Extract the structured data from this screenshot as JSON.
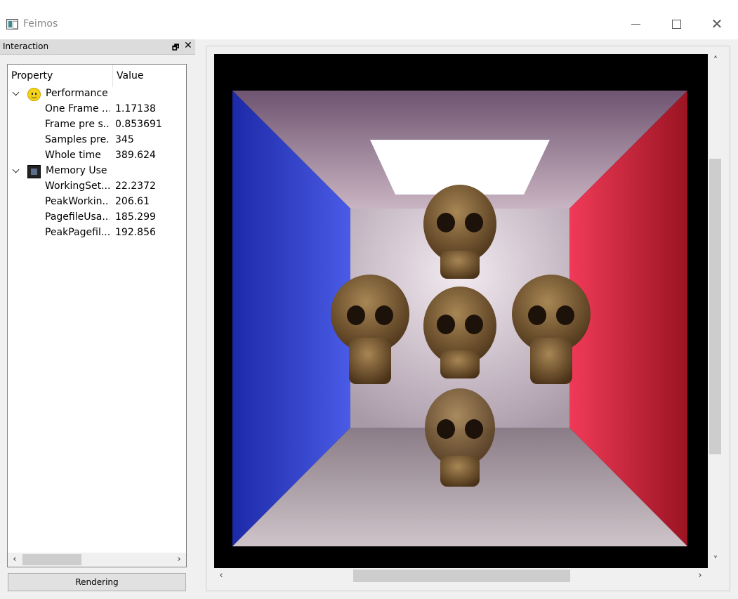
{
  "window": {
    "title": "Feimos"
  },
  "dock": {
    "title": "Interaction",
    "float_glyph": "🗗",
    "close_glyph": "✕"
  },
  "tree": {
    "columns": {
      "property": "Property",
      "value": "Value"
    },
    "groups": [
      {
        "label": "Performance",
        "icon": "smiley-icon",
        "children": [
          {
            "label": "One Frame ...",
            "value": "1.17138"
          },
          {
            "label": "Frame pre s...",
            "value": "0.853691"
          },
          {
            "label": "Samples pre...",
            "value": "345"
          },
          {
            "label": "Whole time",
            "value": "389.624"
          }
        ]
      },
      {
        "label": "Memory Use",
        "icon": "memory-chip-icon",
        "children": [
          {
            "label": "WorkingSet...",
            "value": "22.2372"
          },
          {
            "label": "PeakWorkin...",
            "value": "206.61"
          },
          {
            "label": "PagefileUsa...",
            "value": "185.299"
          },
          {
            "label": "PeakPagefil...",
            "value": "192.856"
          }
        ]
      }
    ]
  },
  "buttons": {
    "rendering": "Rendering"
  },
  "scroll": {
    "left": "‹",
    "right": "›",
    "up": "˄",
    "down": "˅"
  },
  "colors": {
    "left_wall": "#2b34c9",
    "right_wall": "#c81d32",
    "back_wall": "#d8cfd6",
    "light": "#ffffff",
    "skull": "#7a5a32"
  }
}
